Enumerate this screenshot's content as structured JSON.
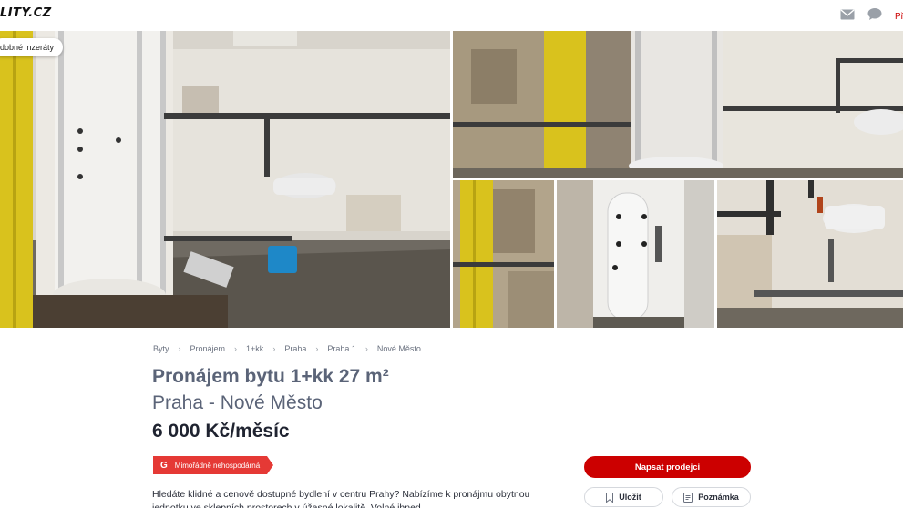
{
  "header": {
    "logo": "LITY.CZ",
    "icons": [
      "mail-icon",
      "chat-icon"
    ],
    "cut_label": "Př"
  },
  "gallery": {
    "similar_pill": "dobné inzeráty"
  },
  "breadcrumb": [
    "Byty",
    "Pronájem",
    "1+kk",
    "Praha",
    "Praha 1",
    "Nové Město"
  ],
  "listing": {
    "title_line1": "Pronájem bytu 1+kk 27 m²",
    "title_line2": "Praha - Nové Město",
    "price": "6 000 Kč/měsíc",
    "energy_class": "G",
    "energy_label": "Mimořádně nehospodárná",
    "description": "Hledáte klidné a cenově dostupné bydlení v centru Prahy? Nabízíme k pronájmu obytnou jednotku ve sklepních prostorech v úžasné lokalitě. Volné ihned."
  },
  "actions": {
    "contact": "Napsat prodejci",
    "save": "Uložit",
    "note": "Poznámka"
  },
  "colors": {
    "brand_red": "#cc0000",
    "energy_red": "#e53935",
    "title_gray": "#5b6478"
  }
}
